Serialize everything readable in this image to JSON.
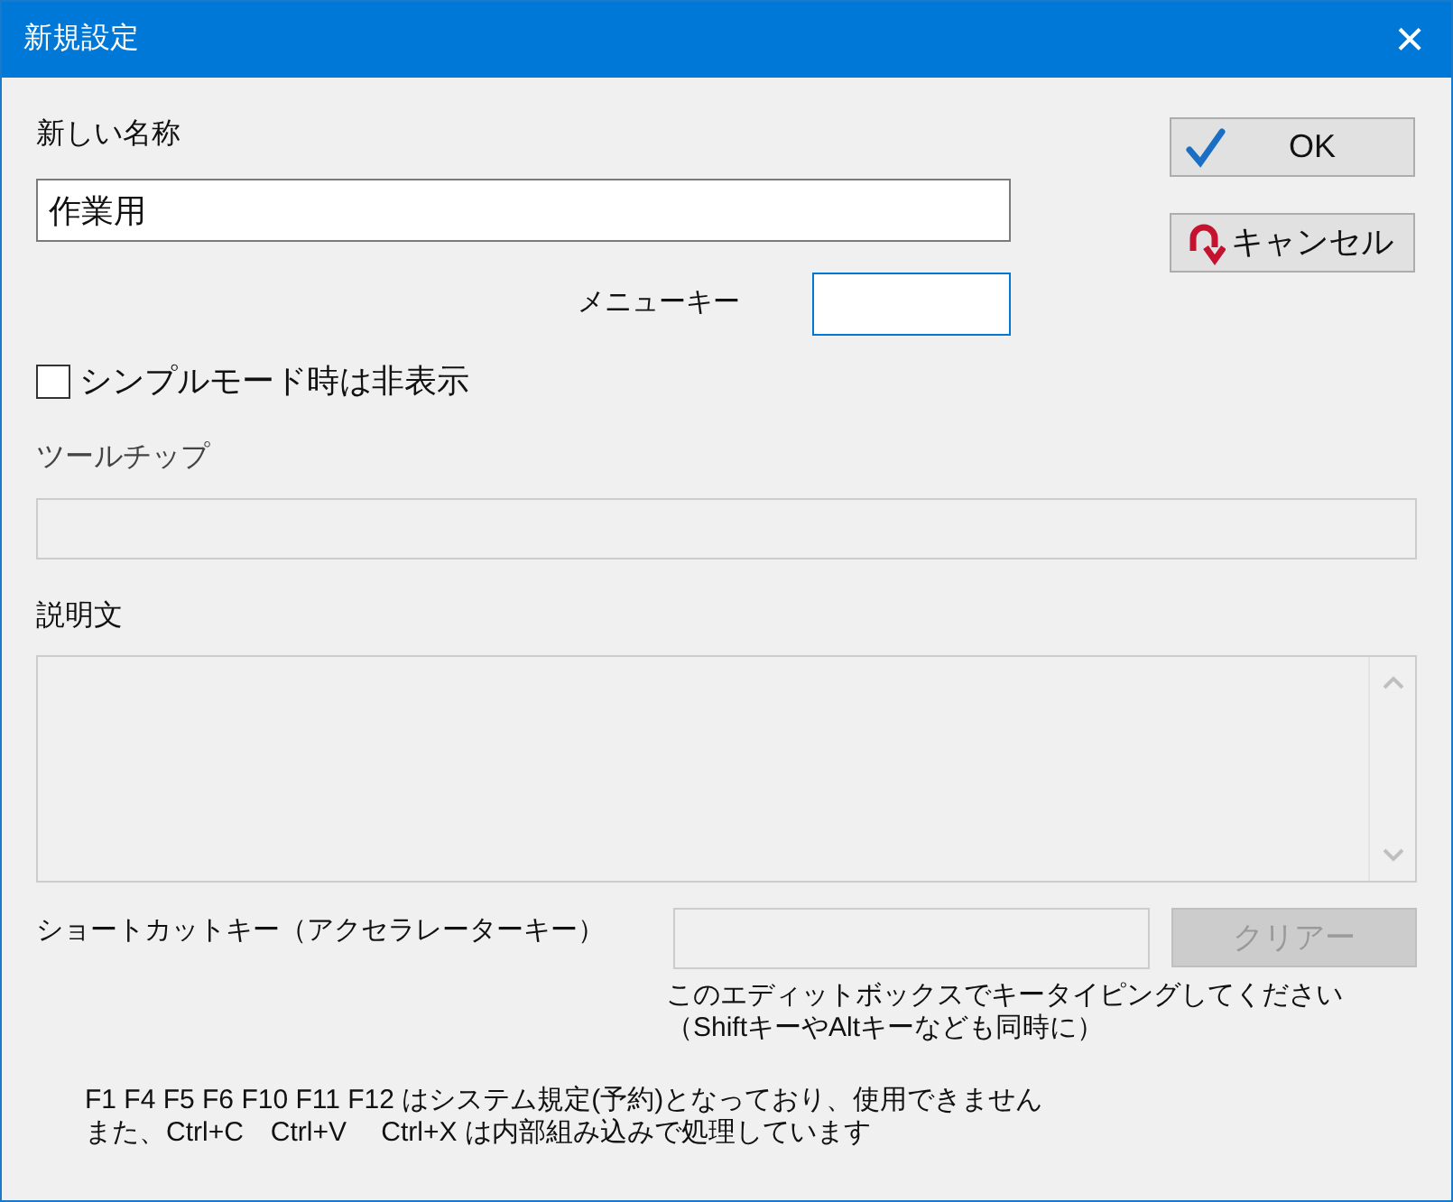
{
  "window": {
    "title": "新規設定",
    "close": "×"
  },
  "name": {
    "label": "新しい名称",
    "value": "作業用"
  },
  "menu_key": {
    "label": "メニューキー"
  },
  "buttons": [
    {
      "kind": "ok",
      "label": "OK",
      "disabled": false
    },
    {
      "kind": "cancel",
      "label": "キャンセル",
      "disabled": false
    }
  ],
  "hide_in_simple": {
    "label": "シンプルモード時は非表示",
    "checked": false
  },
  "tooltip": {
    "label": "ツールチップ",
    "disabled": true
  },
  "description": {
    "label": "説明文",
    "disabled": true
  },
  "shortcut": {
    "label": "ショートカットキー（アクセラレーターキー）",
    "disabled": true,
    "clear": {
      "label": "クリアー",
      "disabled": true
    },
    "hint": [
      "このエディットボックスでキータイピングしてください",
      "（ShiftキーやAltキーなども同時に）"
    ]
  },
  "notes": [
    "F1 F4 F5 F6 F10 F11 F12 はシステム規定(予約)となっており、使用できません",
    "また、Ctrl+C　Ctrl+V　 Ctrl+X は内部組み込みで処理しています"
  ]
}
